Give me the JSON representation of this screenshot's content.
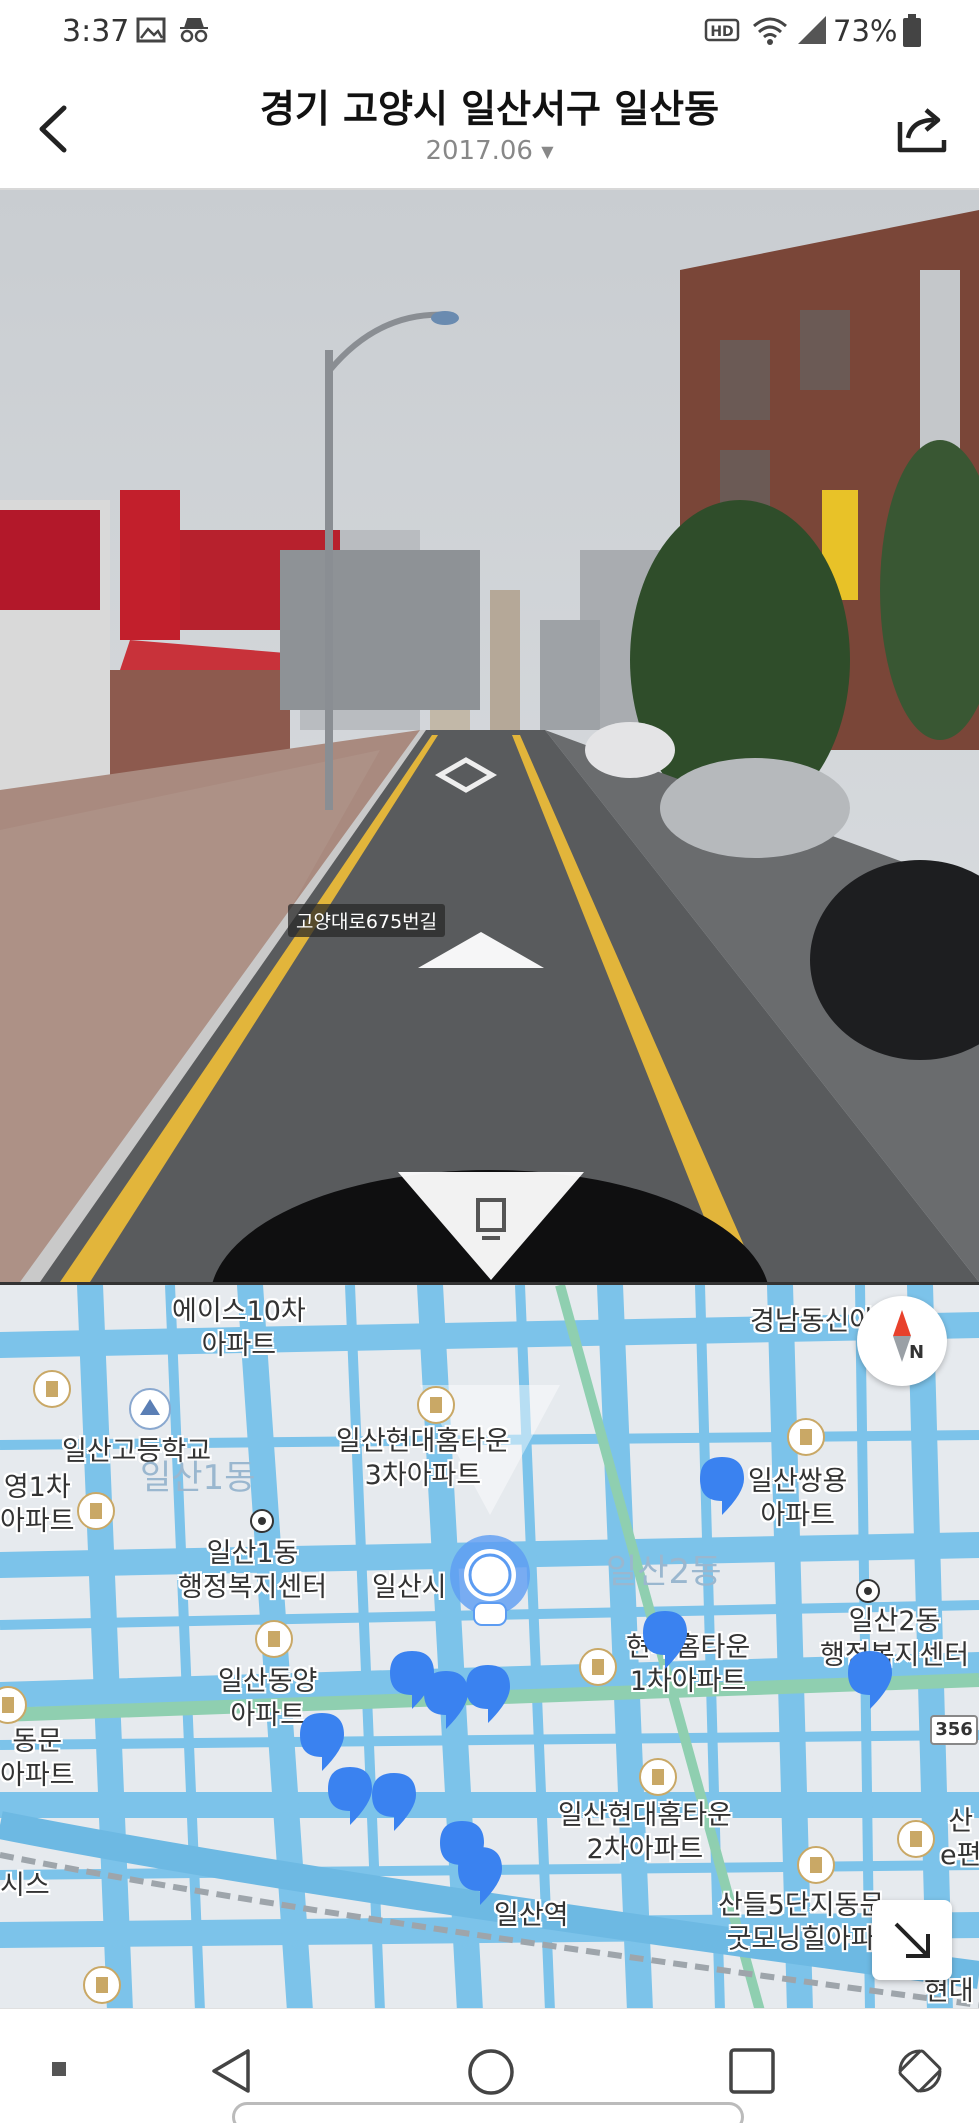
{
  "status_bar": {
    "time": "3:37",
    "battery": "73%",
    "icons": [
      "image-icon",
      "incognito-icon",
      "hd-icon",
      "wifi-icon",
      "signal-icon",
      "battery-icon"
    ]
  },
  "header": {
    "title": "경기 고양시 일산서구 일산동",
    "date": "2017.06"
  },
  "street_view": {
    "road_label": "고양대로675번길"
  },
  "map": {
    "labels": {
      "ace10": "에이스10차\n아파트",
      "gyeongnam": "경남동신아파트",
      "ilsan_high": "일산고등학교",
      "ilsan1dong_faded": "일산1동",
      "hyundai3": "일산현대홈타운\n3차아파트",
      "ssangyong": "일산쌍용\n아파트",
      "apt1cha": "영1차\n아파트",
      "ilsan1_center": "일산1동\n행정복지센터",
      "ilsan_si": "일산시",
      "ilsan2dong_faded": "일산2동",
      "ilsan2_center": "일산2동\n행정복지센터",
      "dongyang": "일산동양\n아파트",
      "hyundai1": "현대홈타운\n1차아파트",
      "dongmun": "동문\n아파트",
      "hyundai2": "일산현대홈타운\n2차아파트",
      "ilsan_station": "일산역",
      "sandeul": "산들5단지동문\n굿모닝힐아파",
      "hyundai_e": "현대",
      "partial_right": "산\ne편",
      "partial_left": "시스"
    },
    "route_number": "356"
  },
  "colors": {
    "road_blue": "#7cc3ea",
    "marker_blue": "#3a82f0"
  }
}
